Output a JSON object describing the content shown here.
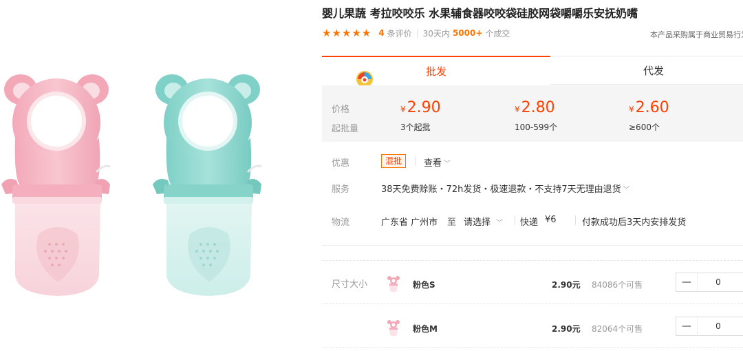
{
  "product": {
    "title": "婴儿果蔬 考拉咬咬乐 水果辅食器咬咬袋硅胶网袋嚼嚼乐安抚奶嘴",
    "stars": "★★★★★",
    "review_count": "4",
    "review_label": "条评价",
    "sales_period": "30天内",
    "sales_count": "5000+",
    "sales_label": "个成交",
    "notice": "本产品采购属于商业贸易行为"
  },
  "tabs": [
    {
      "label": "批发"
    },
    {
      "label": "代发"
    }
  ],
  "price_box": {
    "price_label": "价格",
    "moq_label": "起批量",
    "currency": "¥",
    "tiers": [
      {
        "price": "2.90",
        "range": "3个起批"
      },
      {
        "price": "2.80",
        "range": "100-599个"
      },
      {
        "price": "2.60",
        "range": "≥600个"
      }
    ]
  },
  "offers": {
    "label": "优惠",
    "tag": "混批",
    "view": "查看"
  },
  "service": {
    "label": "服务",
    "text": "38天免费赊账・72h发货・极速退款・不支持7天无理由退货"
  },
  "logistics": {
    "label": "物流",
    "origin": "广东省 广州市",
    "to": "至",
    "dest_select": "请选择",
    "express": "快递",
    "fee": "¥6",
    "shipping_note": "付款成功后3天内安排发货"
  },
  "sku": {
    "label": "尺寸大小",
    "unit_suffix": "元",
    "rows": [
      {
        "name": "粉色S",
        "price": "2.90",
        "stock": "84086个可售",
        "qty": "0",
        "minus": "—"
      },
      {
        "name": "粉色M",
        "price": "2.90",
        "stock": "82064个可售",
        "qty": "0",
        "minus": "—"
      }
    ]
  },
  "colors": {
    "accent": "#ff4000",
    "accent_orange": "#ff7300",
    "pink_product": "#f4b6c2",
    "mint_product": "#8fd8d0"
  }
}
